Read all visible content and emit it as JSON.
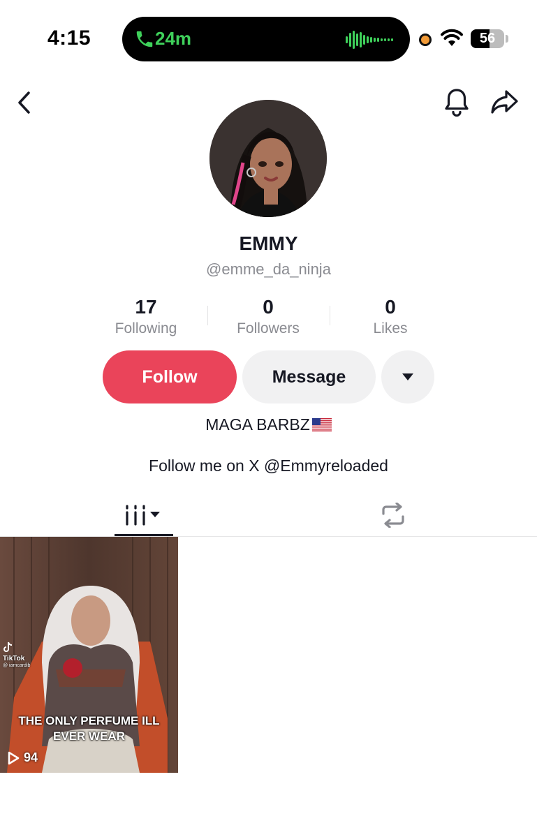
{
  "status_bar": {
    "time": "4:15",
    "call_duration": "24m",
    "battery_level": "56",
    "battery_fraction": 0.56,
    "call_color": "#3fd15b"
  },
  "profile": {
    "display_name": "EMMY",
    "username": "@emme_da_ninja",
    "avatar_icon": "avatar-illustration"
  },
  "stats": [
    {
      "value": "17",
      "label": "Following"
    },
    {
      "value": "0",
      "label": "Followers"
    },
    {
      "value": "0",
      "label": "Likes"
    }
  ],
  "actions": {
    "follow_label": "Follow",
    "message_label": "Message",
    "more_icon": "caret-down-icon",
    "follow_color": "#ea445a"
  },
  "bio": {
    "line1": "MAGA BARBZ",
    "line1_emoji": "us-flag",
    "line2": "Follow me on X @Emmyreloaded"
  },
  "tabs": [
    {
      "icon": "videos-grid-icon",
      "active": true
    },
    {
      "icon": "repost-icon",
      "active": false
    }
  ],
  "videos": [
    {
      "caption_line1": "THE ONLY PERFUME ILL",
      "caption_line2": "EVER WEAR",
      "watermark": "TikTok",
      "watermark_handle": "@ iamcardib",
      "play_count": "94"
    }
  ]
}
